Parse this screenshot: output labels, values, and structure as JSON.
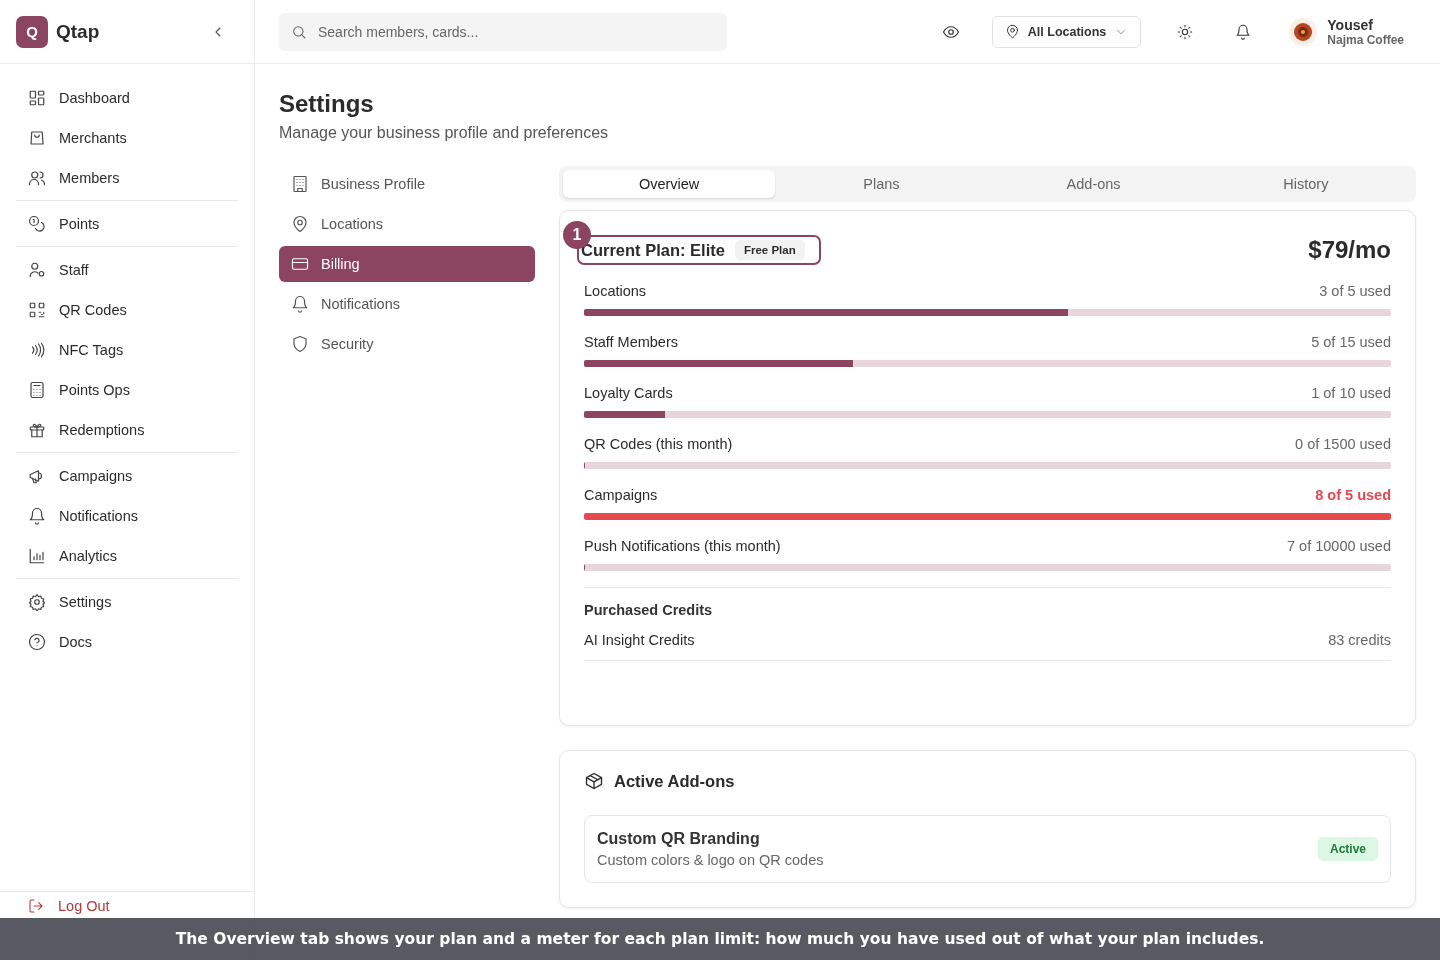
{
  "brand": {
    "logo_letter": "Q",
    "name": "Qtap"
  },
  "nav_groups": [
    {
      "items": [
        "Dashboard",
        "Merchants",
        "Members"
      ]
    },
    {
      "items": [
        "Points"
      ]
    },
    {
      "items": [
        "Staff",
        "QR Codes",
        "NFC Tags",
        "Points Ops",
        "Redemptions"
      ]
    },
    {
      "items": [
        "Campaigns",
        "Notifications",
        "Analytics"
      ]
    },
    {
      "items": [
        "Settings",
        "Docs"
      ]
    }
  ],
  "logout": "Log Out",
  "search": {
    "placeholder": "Search members, cards..."
  },
  "location_select": {
    "value": "All Locations"
  },
  "user": {
    "name": "Yousef",
    "business": "Najma Coffee"
  },
  "page": {
    "title": "Settings",
    "subtitle": "Manage your business profile and preferences"
  },
  "settings_menu": [
    {
      "label": "Business Profile",
      "selected": false
    },
    {
      "label": "Locations",
      "selected": false
    },
    {
      "label": "Billing",
      "selected": true
    },
    {
      "label": "Notifications",
      "selected": false
    },
    {
      "label": "Security",
      "selected": false
    }
  ],
  "tabs": [
    {
      "label": "Overview",
      "selected": true
    },
    {
      "label": "Plans",
      "selected": false
    },
    {
      "label": "Add-ons",
      "selected": false
    },
    {
      "label": "History",
      "selected": false
    }
  ],
  "plan": {
    "callout_number": "1",
    "title": "Current Plan: Elite",
    "badge": "Free Plan",
    "price": "$79/mo",
    "meters": [
      {
        "name": "Locations",
        "reading": "3 of 5 used",
        "level": 0.6,
        "over": false
      },
      {
        "name": "Staff Members",
        "reading": "5 of 15 used",
        "level": 0.333,
        "over": false
      },
      {
        "name": "Loyalty Cards",
        "reading": "1 of 10 used",
        "level": 0.1,
        "over": false
      },
      {
        "name": "QR Codes (this month)",
        "reading": "0 of 1500 used",
        "level": 0,
        "over": false
      },
      {
        "name": "Campaigns",
        "reading": "8 of 5 used",
        "level": 1,
        "over": true
      },
      {
        "name": "Push Notifications (this month)",
        "reading": "7 of 10000 used",
        "level": 0.0007,
        "over": false
      }
    ],
    "credits_heading": "Purchased Credits",
    "credits": [
      {
        "name": "AI Insight Credits",
        "value": "83 credits"
      }
    ]
  },
  "addons": {
    "heading": "Active Add-ons",
    "items": [
      {
        "name": "Custom QR Branding",
        "description": "Custom colors & logo on QR codes",
        "status": "Active"
      }
    ]
  },
  "caption": "The Overview tab shows your plan and a meter for each plan limit: how much you have used out of what your plan includes."
}
